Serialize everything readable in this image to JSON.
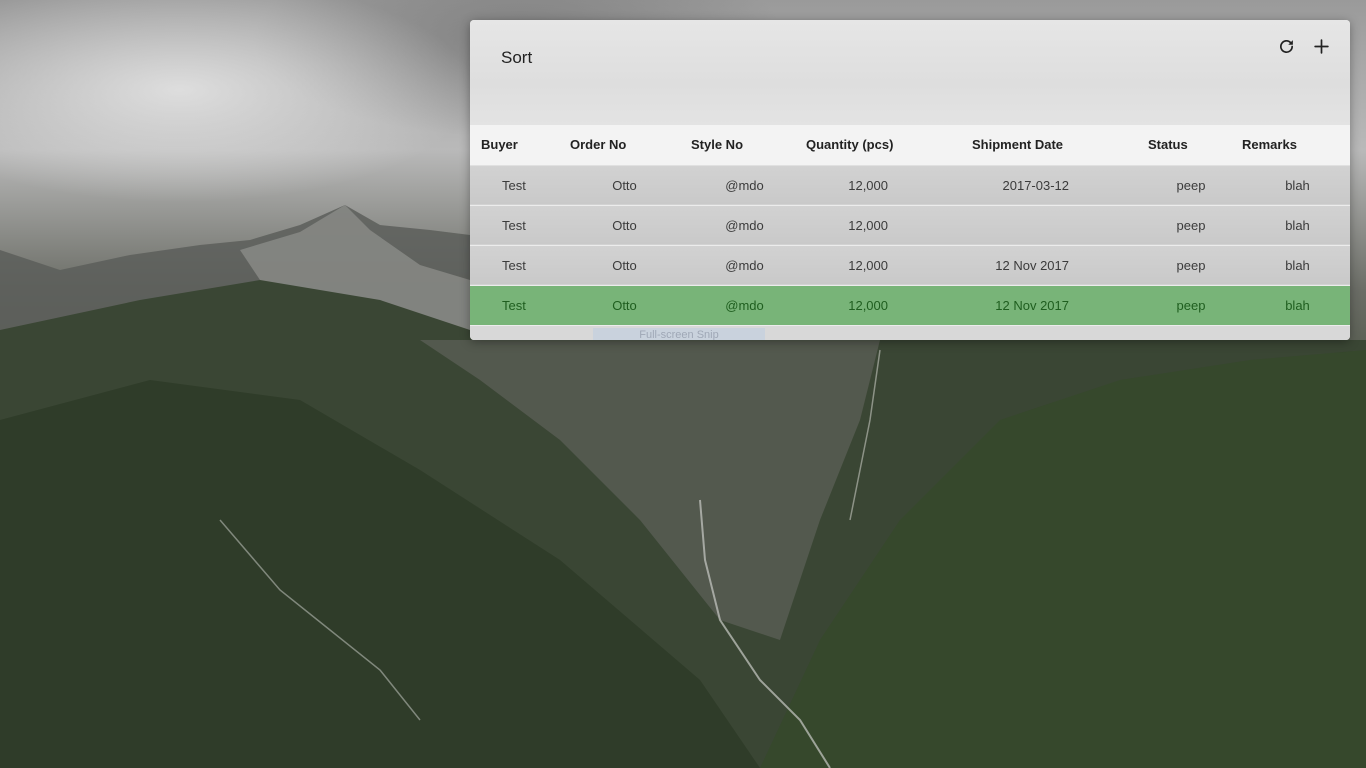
{
  "panel": {
    "title": "Sort",
    "actions": [
      {
        "icon": "refresh-icon"
      },
      {
        "icon": "plus-icon"
      }
    ]
  },
  "table": {
    "columns": [
      "Buyer",
      "Order No",
      "Style No",
      "Quantity (pcs)",
      "Shipment Date",
      "Status",
      "Remarks"
    ],
    "rows": [
      {
        "buyer": "Test",
        "order_no": "Otto",
        "style_no": "@mdo",
        "quantity": "12,000",
        "shipment_date": "2017-03-12",
        "status": "peep",
        "remarks": "blah",
        "selected": false
      },
      {
        "buyer": "Test",
        "order_no": "Otto",
        "style_no": "@mdo",
        "quantity": "12,000",
        "shipment_date": "",
        "status": "peep",
        "remarks": "blah",
        "selected": false
      },
      {
        "buyer": "Test",
        "order_no": "Otto",
        "style_no": "@mdo",
        "quantity": "12,000",
        "shipment_date": "12 Nov 2017",
        "status": "peep",
        "remarks": "blah",
        "selected": false
      },
      {
        "buyer": "Test",
        "order_no": "Otto",
        "style_no": "@mdo",
        "quantity": "12,000",
        "shipment_date": "12 Nov 2017",
        "status": "peep",
        "remarks": "blah",
        "selected": true
      }
    ]
  },
  "footer": {
    "hint": "Full-screen Snip"
  },
  "colors": {
    "selected_row": "#78b478",
    "selected_text": "#1f5e1f",
    "panel": "#eeeeee"
  }
}
